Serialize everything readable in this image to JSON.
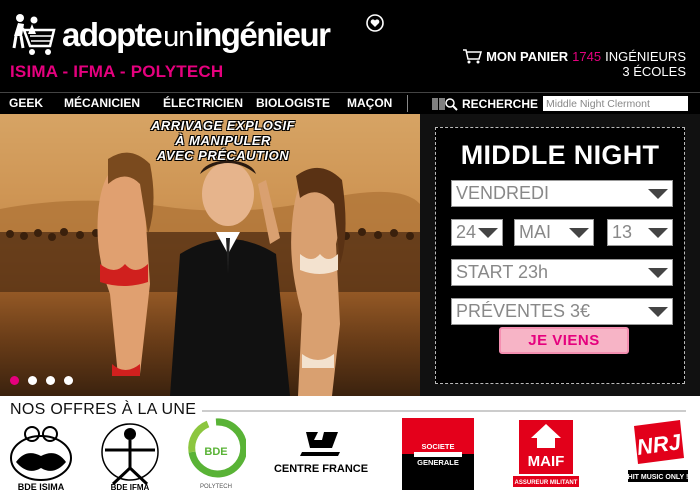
{
  "brand": {
    "word1": "adopte",
    "word2": "un",
    "word3": "ingénieur",
    "schools": "ISIMA - IFMA - POLYTECH"
  },
  "cart": {
    "label": "MON PANIER",
    "count": "1745",
    "count_unit": "INGÉNIEURS",
    "schools": "3 ÉCOLES"
  },
  "nav": {
    "items": [
      "GEEK",
      "MÉCANICIEN",
      "ÉLECTRICIEN",
      "BIOLOGISTE",
      "MAÇON"
    ],
    "search_label": "RECHERCHE",
    "search_value": "Middle Night Clermont"
  },
  "hero": {
    "tagline": [
      "ARRIVAGE EXPLOSIF",
      "À MANIPULER",
      "AVEC PRÉCAUTION"
    ],
    "slide_active": 0,
    "slide_count": 4
  },
  "event": {
    "title": "MIDDLE NIGHT",
    "day": "VENDREDI",
    "date_day": "24",
    "date_month": "MAI",
    "date_year": "13",
    "start": "START 23h",
    "presale": "PRÉVENTES 3€",
    "button": "JE VIENS"
  },
  "offers": {
    "title": "NOS OFFRES À LA UNE",
    "sponsors": [
      {
        "name": "BDE ISIMA"
      },
      {
        "name": "BDE IFMA"
      },
      {
        "name": "BDE",
        "sub": "POLYTECH"
      },
      {
        "name": "CENTRE FRANCE"
      },
      {
        "name": "SOCIETE",
        "sub": "GENERALE"
      },
      {
        "name": "MAIF",
        "sub": "ASSUREUR MILITANT"
      },
      {
        "name": "NRJ",
        "sub": "HIT MUSIC ONLY !"
      }
    ]
  },
  "colors": {
    "accent": "#e5007e",
    "header_bg": "#000000",
    "button_bg": "#f7b4c6"
  }
}
